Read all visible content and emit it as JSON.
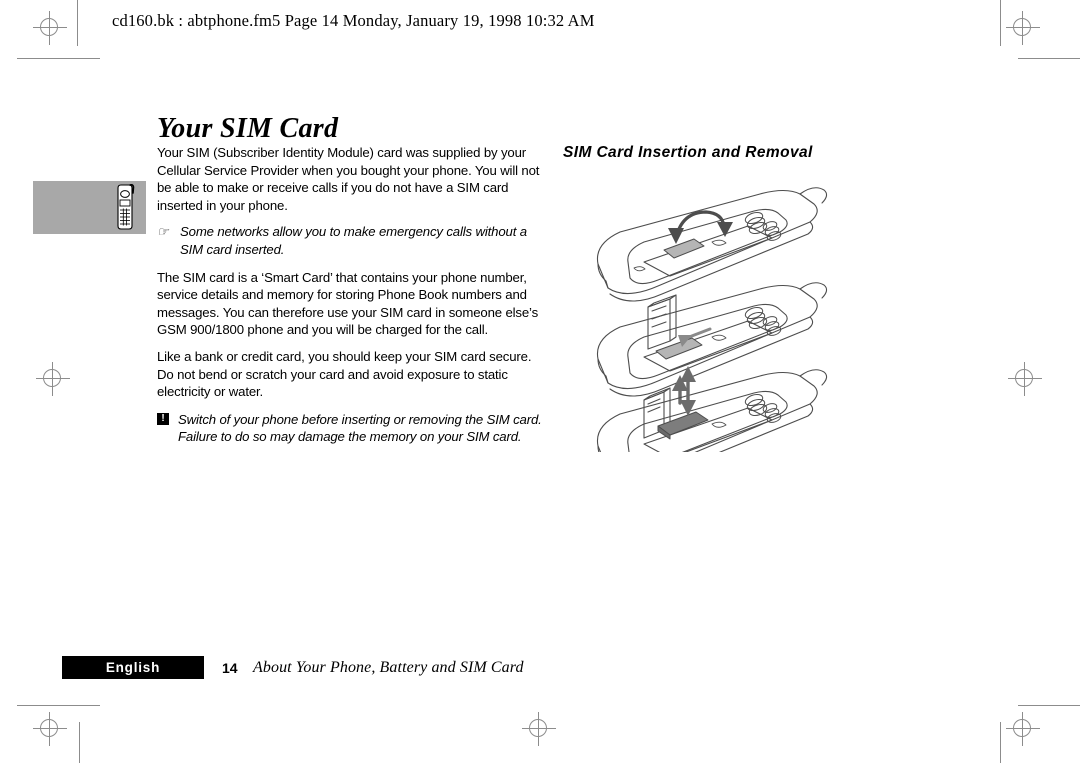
{
  "page": {
    "header_line": "cd160.bk : abtphone.fm5  Page 14  Monday, January 19, 1998  10:32 AM",
    "chapter_title": "Your SIM Card"
  },
  "margin": {
    "icon_name": "mobile-phone-illustration"
  },
  "left_column": {
    "paragraph_1": "Your SIM (Subscriber Identity Module) card was supplied by your Cellular Service Provider when you bought your phone. You will not be able to make or receive calls if you do not have a SIM card inserted in your phone.",
    "note": {
      "icon": "☞",
      "icon_name": "pointing-hand-icon",
      "text": "Some networks allow you to make emergency calls without a SIM card inserted."
    },
    "paragraph_2": "The SIM card is a ‘Smart Card’ that contains your phone number, service details and memory for storing Phone Book numbers and messages. You can therefore use your SIM card in someone else’s GSM 900/1800 phone and you will be charged for the call.",
    "paragraph_3": "Like a bank or credit card, you should keep your SIM card secure. Do not bend or scratch your card and avoid exposure to static electricity or water.",
    "warning": {
      "icon": "!",
      "icon_name": "exclamation-warning-icon",
      "text": "Switch of your phone before inserting or removing the SIM card. Failure to do so may damage the memory on your SIM card."
    }
  },
  "right_column": {
    "section_heading": "SIM Card Insertion and Removal",
    "figures": [
      {
        "name": "phone-battery-compartment-open",
        "caption": "",
        "arrow": "curved-up-arrow"
      },
      {
        "name": "sim-holder-lifted",
        "caption": "",
        "arrow": "up-arrow"
      },
      {
        "name": "sim-card-insertion",
        "caption": "",
        "arrow": "double-headed-vertical-arrow"
      }
    ]
  },
  "footer": {
    "language_tab": "English",
    "page_number": "14",
    "running_title": "About Your Phone, Battery and SIM Card"
  },
  "colors": {
    "margin_block": "#a8a8a8",
    "footer_tab_bg": "#000000",
    "footer_tab_text": "#ffffff",
    "registration_mark": "#8c8c8c",
    "line_art": "#4d4d4d"
  }
}
